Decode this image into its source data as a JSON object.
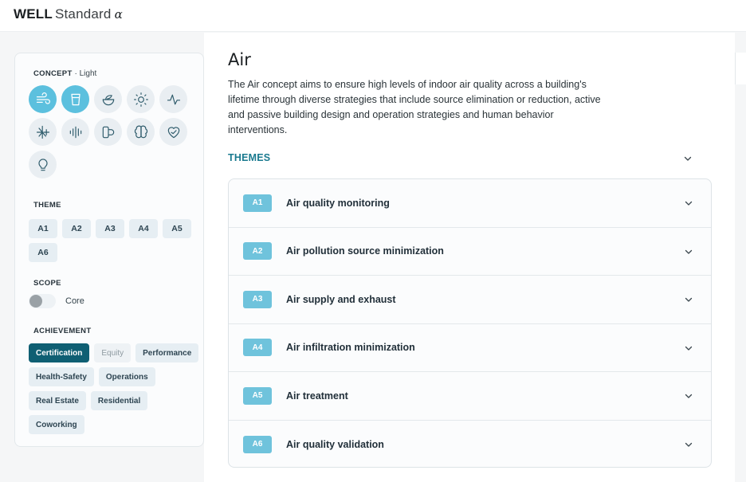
{
  "header": {
    "brand_bold": "WELL",
    "brand_light": "Standard",
    "brand_alpha": "α"
  },
  "sidebar": {
    "concept_label": "CONCEPT",
    "concept_sub": "· Light",
    "concept_icons": [
      {
        "name": "air-icon",
        "active": true
      },
      {
        "name": "water-icon",
        "active": true
      },
      {
        "name": "nourishment-icon",
        "active": false
      },
      {
        "name": "light-icon",
        "active": false
      },
      {
        "name": "movement-icon",
        "active": false
      },
      {
        "name": "thermal-comfort-icon",
        "active": false
      },
      {
        "name": "sound-icon",
        "active": false
      },
      {
        "name": "materials-icon",
        "active": false
      },
      {
        "name": "mind-icon",
        "active": false
      },
      {
        "name": "community-icon",
        "active": false
      },
      {
        "name": "innovation-icon",
        "active": false
      }
    ],
    "theme_label": "THEME",
    "themes": [
      "A1",
      "A2",
      "A3",
      "A4",
      "A5",
      "A6"
    ],
    "scope_label": "SCOPE",
    "scope_value": "Core",
    "achievement_label": "ACHIEVEMENT",
    "achievements": [
      {
        "label": "Certification",
        "state": "active"
      },
      {
        "label": "Equity",
        "state": "muted"
      },
      {
        "label": "Performance",
        "state": "normal"
      },
      {
        "label": "Health-Safety",
        "state": "normal"
      },
      {
        "label": "Operations",
        "state": "normal"
      },
      {
        "label": "Real Estate",
        "state": "normal"
      },
      {
        "label": "Residential",
        "state": "normal"
      },
      {
        "label": "Coworking",
        "state": "normal"
      }
    ]
  },
  "main": {
    "title": "Air",
    "description": "The Air concept aims to ensure high levels of indoor air quality across a building's lifetime through diverse strategies that include source elimination or reduction, active and passive building design and operation strategies and human behavior interventions.",
    "themes_label": "THEMES",
    "themes": [
      {
        "code": "A1",
        "title": "Air quality monitoring"
      },
      {
        "code": "A2",
        "title": "Air pollution source minimization"
      },
      {
        "code": "A3",
        "title": "Air supply and exhaust"
      },
      {
        "code": "A4",
        "title": "Air infiltration minimization"
      },
      {
        "code": "A5",
        "title": "Air treatment"
      },
      {
        "code": "A6",
        "title": "Air quality validation"
      }
    ]
  },
  "colors": {
    "accent": "#1a7a8f",
    "active_icon": "#5cc0de",
    "badge": "#6fc3dc",
    "chip_active": "#0f5f73"
  }
}
